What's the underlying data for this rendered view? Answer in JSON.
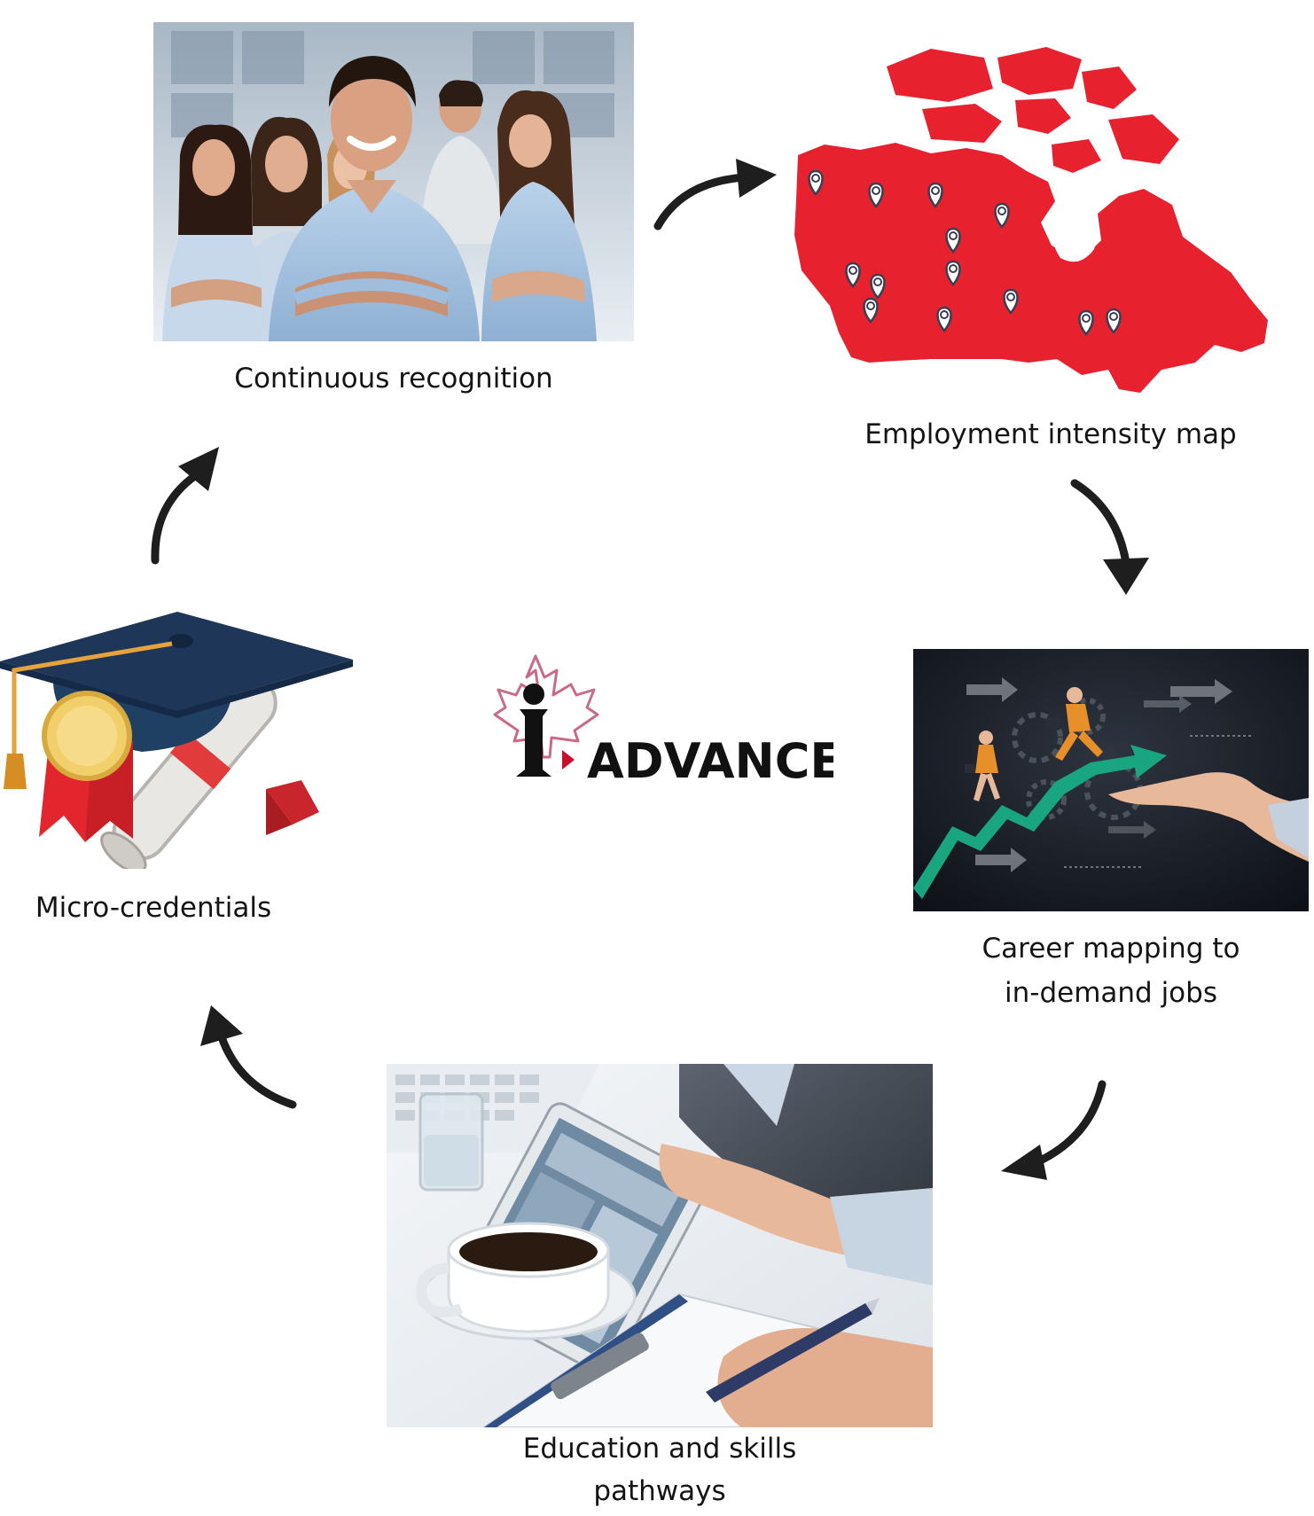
{
  "steps": {
    "recognition": {
      "label": "Continuous recognition",
      "image": "team-photo"
    },
    "map": {
      "label": "Employment intensity map",
      "image": "canada-map-with-pins"
    },
    "career": {
      "label_line1": "Career mapping to",
      "label_line2": "in-demand jobs",
      "image": "career-growth-graphic"
    },
    "education": {
      "label_line1": "Education and skills",
      "label_line2": "pathways",
      "image": "meeting-table-photo"
    },
    "micro": {
      "label": "Micro-credentials",
      "image": "graduation-cap-diploma-medal"
    }
  },
  "logo": {
    "wordmark": "ADVANCE",
    "letter": "I"
  },
  "colors": {
    "map_red": "#e8212f",
    "logo_red": "#c8102e",
    "arrow": "#1e1e1e",
    "green_arrow": "#1aa581"
  }
}
